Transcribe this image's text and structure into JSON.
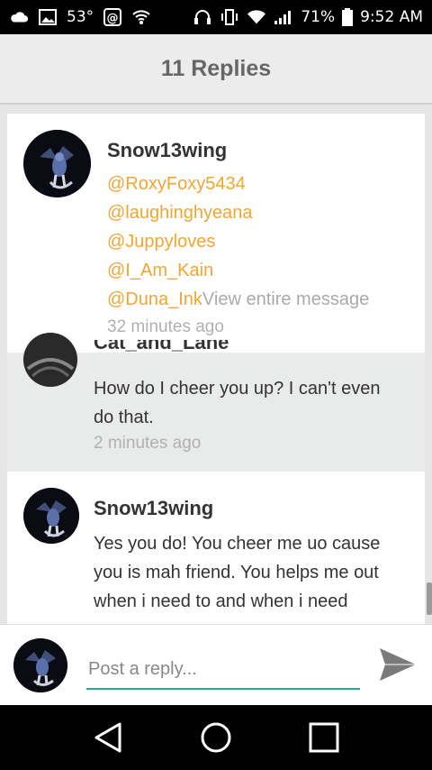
{
  "status_bar": {
    "temperature": "53°",
    "battery_percent": "71%",
    "time": "9:52 AM"
  },
  "header": {
    "title": "11 Replies"
  },
  "messages": [
    {
      "author": "Snow13wing",
      "mentions": [
        "@RoxyFoxy5434",
        "@laughinghyeana",
        "@Juppyloves",
        "@I_Am_Kain"
      ],
      "last_mention": "@Duna_Ink",
      "more_link": "View entire message",
      "time": "32 minutes ago"
    },
    {
      "author": "Cat_and_Lane",
      "body_line1": "How do I cheer you up? I can't even",
      "body_line2": "do that.",
      "time": "2 minutes ago"
    },
    {
      "author": "Snow13wing",
      "body_line1": "Yes you do! You cheer me uo cause",
      "body_line2": "you is mah friend. You helps me out",
      "body_line3": "when i need to and when i need"
    }
  ],
  "reply": {
    "placeholder": "Post a reply..."
  },
  "colors": {
    "mention": "#f2a531",
    "accent": "#27a6a0",
    "title": "#666666"
  }
}
